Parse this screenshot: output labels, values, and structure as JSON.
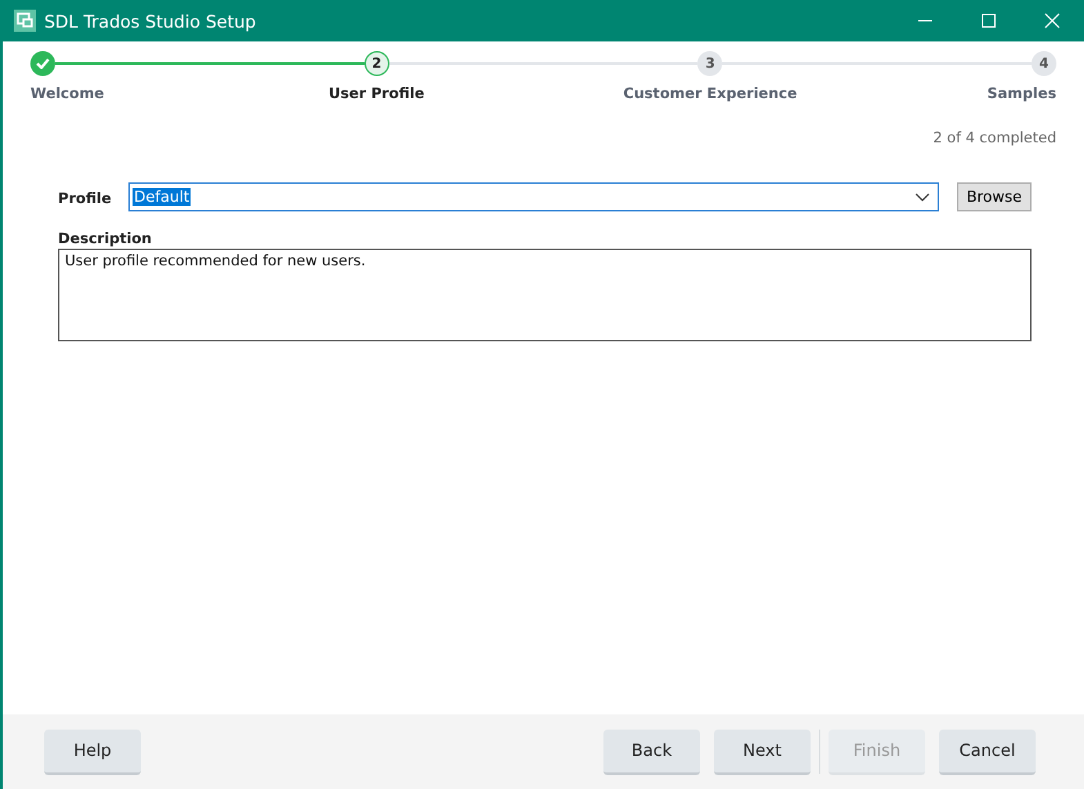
{
  "window": {
    "title": "SDL Trados Studio Setup"
  },
  "steps": [
    {
      "label": "Welcome",
      "completed": true,
      "selected": false
    },
    {
      "number": "2",
      "label": "User Profile",
      "completed": false,
      "selected": true
    },
    {
      "number": "3",
      "label": "Customer Experience",
      "completed": false,
      "selected": false
    },
    {
      "number": "4",
      "label": "Samples",
      "completed": false,
      "selected": false
    }
  ],
  "progress_text": "2 of 4 completed",
  "profile": {
    "label": "Profile",
    "value": "Default",
    "browse": "Browse"
  },
  "description": {
    "label": "Description",
    "text": "User profile recommended for new users."
  },
  "buttons": [
    {
      "label": "Help",
      "disabled": false
    },
    {
      "label": "Back",
      "disabled": false
    },
    {
      "label": "Next",
      "disabled": false
    },
    {
      "label": "Finish",
      "disabled": true
    },
    {
      "label": "Cancel",
      "disabled": false
    }
  ]
}
